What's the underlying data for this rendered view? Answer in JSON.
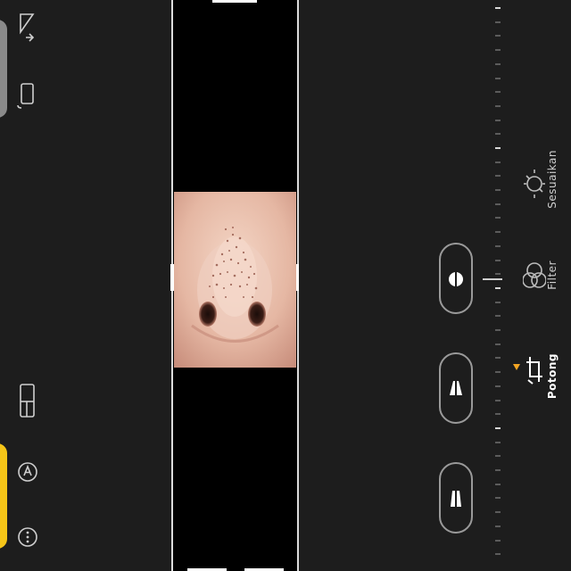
{
  "editor": {
    "modes": [
      {
        "id": "potong",
        "label": "Potong",
        "active": true
      },
      {
        "id": "filter",
        "label": "Filter",
        "active": false
      },
      {
        "id": "sesuaikan",
        "label": "Sesuaikan",
        "active": false
      }
    ],
    "left_toolbar": {
      "top_icons": [
        "flip-icon",
        "rotate-icon"
      ],
      "bottom_icons": [
        "aspect-ratio-icon",
        "markup-icon",
        "more-icon"
      ]
    },
    "perspective_controls": [
      "straighten-icon",
      "vertical-perspective-icon",
      "horizontal-perspective-icon"
    ]
  },
  "colors": {
    "accent": "#f5c518",
    "background": "#1d1d1d",
    "marker": "#f5a623"
  }
}
